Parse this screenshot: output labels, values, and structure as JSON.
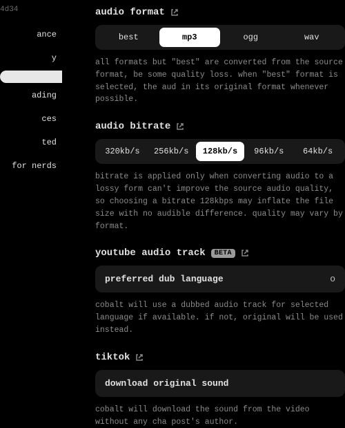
{
  "sidebar": {
    "hash": "4d34",
    "items": [
      {
        "label": "ance"
      },
      {
        "label": "y"
      },
      {
        "label": ""
      },
      {
        "label": "ading"
      },
      {
        "label": "ces"
      },
      {
        "label": "ted"
      },
      {
        "label": "for nerds"
      }
    ],
    "active_index": 2
  },
  "sections": {
    "audio_format": {
      "title": "audio format",
      "options": [
        "best",
        "mp3",
        "ogg",
        "wav"
      ],
      "selected": "mp3",
      "desc": "all formats but \"best\" are converted from the source format, be some quality loss. when \"best\" format is selected, the aud in its original format whenever possible."
    },
    "audio_bitrate": {
      "title": "audio bitrate",
      "options": [
        "320kb/s",
        "256kb/s",
        "128kb/s",
        "96kb/s",
        "64kb/s"
      ],
      "selected": "128kb/s",
      "desc": "bitrate is applied only when converting audio to a lossy form can't improve the source audio quality, so choosing a bitrate 128kbps may inflate the file size with no audible difference. quality may vary by format."
    },
    "youtube_track": {
      "title": "youtube audio track",
      "badge": "BETA",
      "row_label": "preferred dub language",
      "row_value": "o",
      "desc": "cobalt will use a dubbed audio track for selected language if available. if not, original will be used instead."
    },
    "tiktok": {
      "title": "tiktok",
      "row_label": "download original sound",
      "desc": "cobalt will download the sound from the video without any cha post's author."
    }
  }
}
